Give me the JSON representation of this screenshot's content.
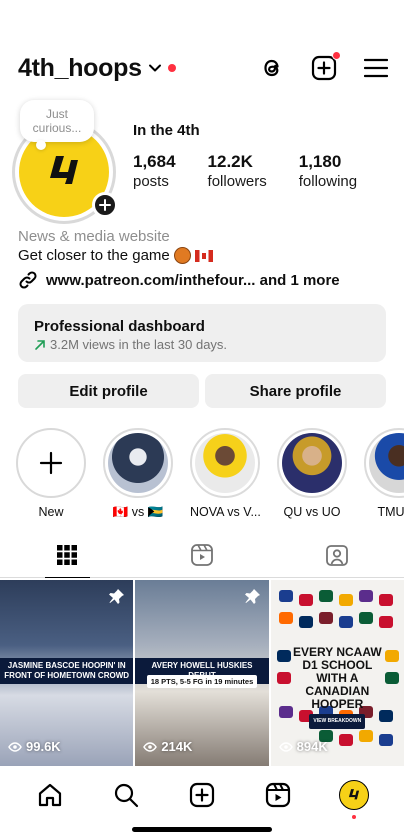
{
  "header": {
    "username": "4th_hoops"
  },
  "profile": {
    "note": "Just curious...",
    "display_name": "In the 4th",
    "stats": [
      {
        "count": "1,684",
        "label": "posts"
      },
      {
        "count": "12.2K",
        "label": "followers"
      },
      {
        "count": "1,180",
        "label": "following"
      }
    ],
    "category": "News & media website",
    "bio": "Get closer to the game",
    "link": "www.patreon.com/inthefour... and 1 more"
  },
  "dashboard": {
    "title": "Professional dashboard",
    "subtitle": "3.2M views in the last 30 days."
  },
  "buttons": {
    "edit": "Edit profile",
    "share": "Share profile"
  },
  "highlights": [
    {
      "label": "New"
    },
    {
      "label": "🇨🇦 vs 🇧🇸"
    },
    {
      "label": "NOVA vs V..."
    },
    {
      "label": "QU vs UO"
    },
    {
      "label": "TMU vs"
    }
  ],
  "posts": [
    {
      "caption": "JASMINE BASCOE HOOPIN' IN FRONT OF HOMETOWN CROWD",
      "views": "99.6K"
    },
    {
      "caption": "AVERY HOWELL HUSKIES DEBUT",
      "subcaption": "18 PTS, 5-5 FG in 19 minutes",
      "views": "214K"
    },
    {
      "caption": "EVERY NCAAW D1 SCHOOL WITH A CANADIAN HOOPER",
      "badge": "VIEW BREAKDOWN",
      "views": "894K"
    }
  ],
  "colors": {
    "accent_red": "#ff3040",
    "brand_yellow": "#f7d117"
  }
}
